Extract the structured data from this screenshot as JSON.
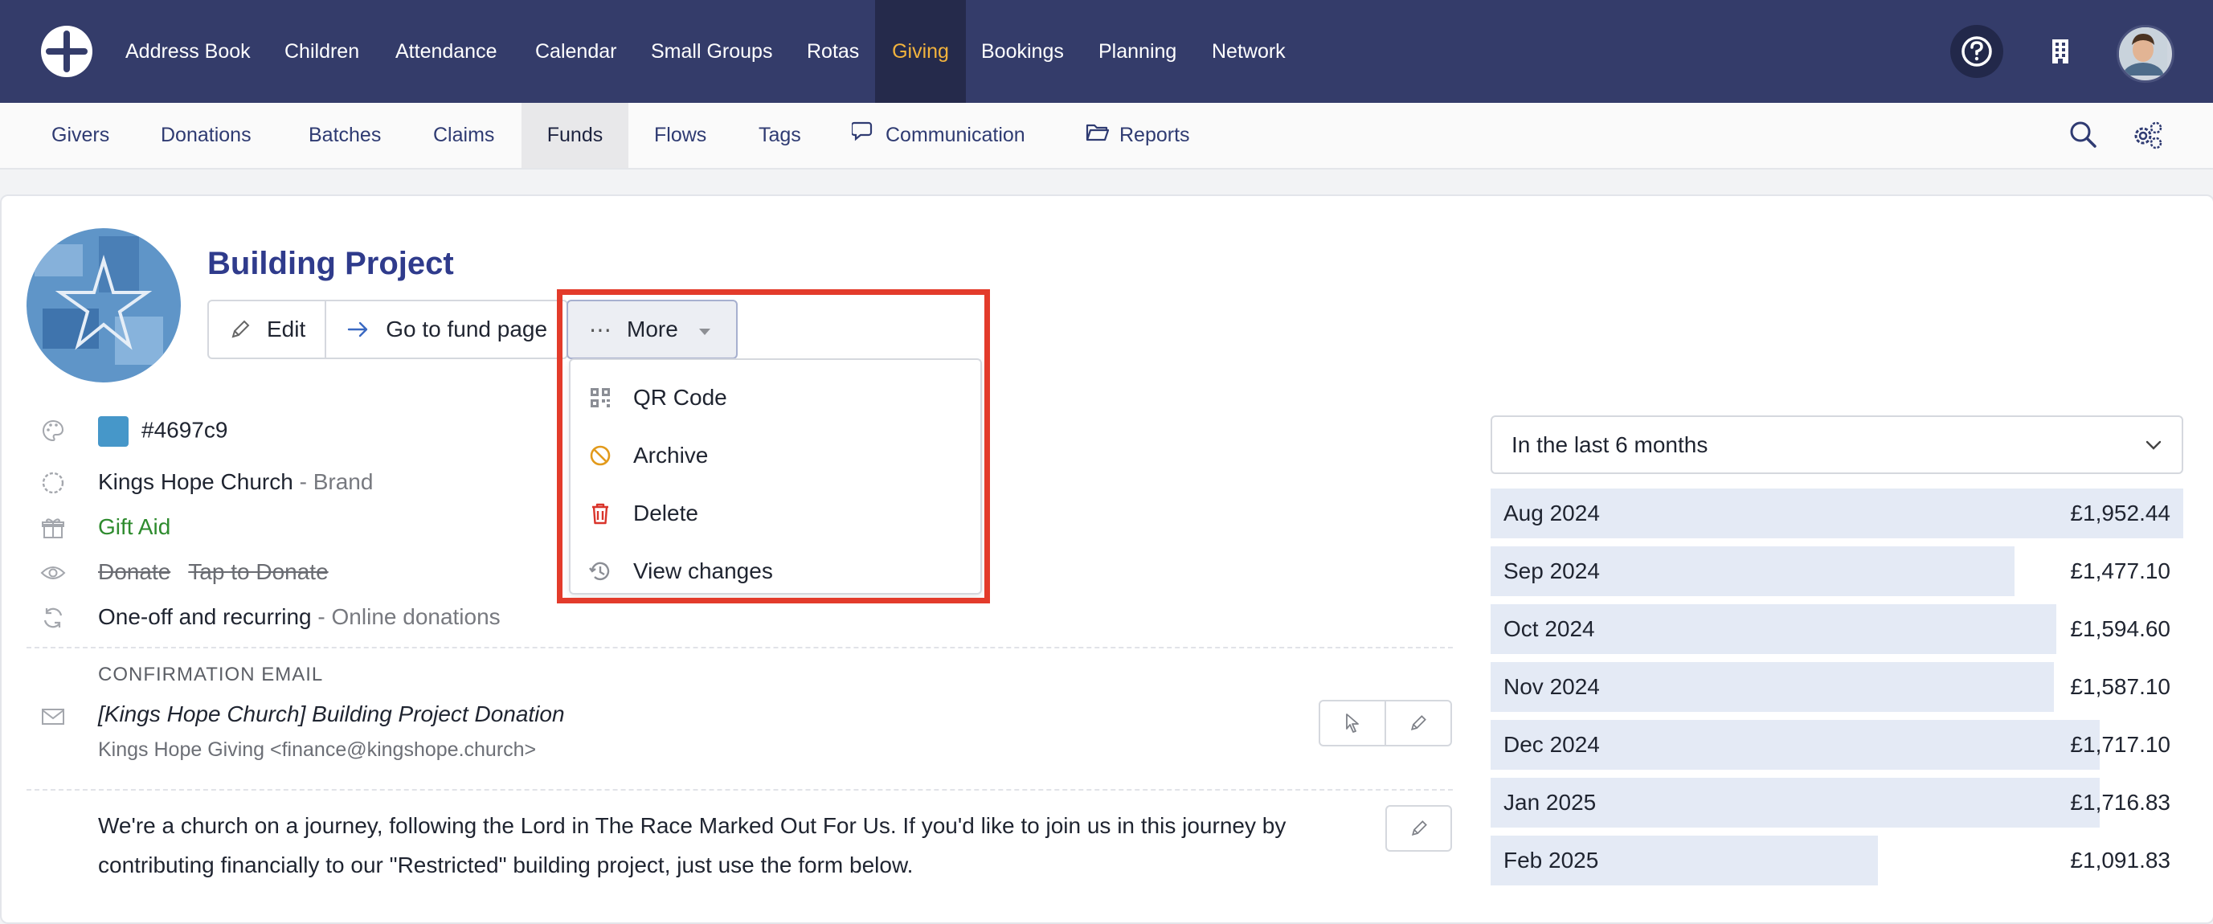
{
  "topnav": {
    "items": [
      {
        "label": "Address Book"
      },
      {
        "label": "Children"
      },
      {
        "label": "Attendance"
      },
      {
        "label": "Calendar"
      },
      {
        "label": "Small Groups"
      },
      {
        "label": "Rotas"
      },
      {
        "label": "Giving",
        "active": true
      },
      {
        "label": "Bookings"
      },
      {
        "label": "Planning"
      },
      {
        "label": "Network"
      }
    ],
    "active_color": "#f2b33d",
    "background": "#343c6a"
  },
  "subnav": {
    "items": [
      {
        "label": "Givers"
      },
      {
        "label": "Donations"
      },
      {
        "label": "Batches"
      },
      {
        "label": "Claims"
      },
      {
        "label": "Funds",
        "active": true
      },
      {
        "label": "Flows"
      },
      {
        "label": "Tags"
      },
      {
        "label": "Communication",
        "icon": "chat-icon"
      },
      {
        "label": "Reports",
        "icon": "folder-icon"
      }
    ]
  },
  "fund": {
    "title": "Building Project",
    "buttons": {
      "edit": "Edit",
      "go": "Go to fund page",
      "more": "More"
    },
    "menu": [
      {
        "label": "QR Code",
        "icon": "qr-code-icon"
      },
      {
        "label": "Archive",
        "icon": "archive-icon"
      },
      {
        "label": "Delete",
        "icon": "trash-icon"
      },
      {
        "label": "View changes",
        "icon": "history-icon"
      }
    ],
    "color_hex": "#4697c9",
    "brand_name": "Kings Hope Church",
    "brand_suffix": " - Brand",
    "gift_aid": "Gift Aid",
    "visibility": {
      "donate": "Donate",
      "tap": "Tap to Donate"
    },
    "frequency": "One-off and recurring",
    "frequency_suffix": " - Online donations",
    "confirmation": {
      "label": "CONFIRMATION EMAIL",
      "subject": "[Kings Hope Church] Building Project Donation",
      "from": "Kings Hope Giving  <finance@kingshope.church>"
    },
    "description": "We're a church on a journey, following the Lord in The Race Marked Out For Us. If you'd like to join us in this journey by contributing financially to our \"Restricted\" building project, just use the form below."
  },
  "period": {
    "selected": "In the last 6 months"
  },
  "chart_data": {
    "type": "bar",
    "categories": [
      "Aug 2024",
      "Sep 2024",
      "Oct 2024",
      "Nov 2024",
      "Dec 2024",
      "Jan 2025",
      "Feb 2025"
    ],
    "values": [
      1952.44,
      1477.1,
      1594.6,
      1587.1,
      1717.1,
      1716.83,
      1091.83
    ],
    "labels": [
      "£1,952.44",
      "£1,477.10",
      "£1,594.60",
      "£1,587.10",
      "£1,717.10",
      "£1,716.83",
      "£1,091.83"
    ],
    "max": 1952.44
  }
}
